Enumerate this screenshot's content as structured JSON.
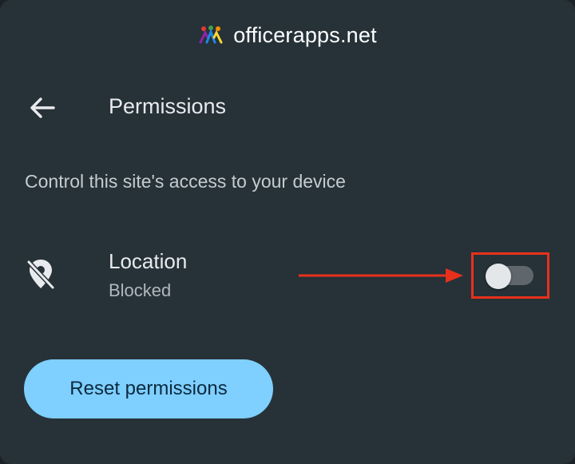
{
  "header": {
    "domain": "officerapps.net",
    "logo_icon": "officerapps-logo-icon"
  },
  "nav": {
    "back_icon": "arrow-left-icon",
    "title": "Permissions"
  },
  "description": "Control this site's access to your device",
  "permissions": [
    {
      "name": "Location",
      "status": "Blocked",
      "icon": "location-off-icon",
      "enabled": false
    }
  ],
  "annotation": {
    "color": "#e8301c",
    "type": "arrow-and-highlight-box"
  },
  "reset_button": {
    "label": "Reset permissions"
  },
  "colors": {
    "background": "#263238",
    "primary_text": "#e8eaed",
    "secondary_text": "#b0b8be",
    "accent_button": "#7fcfff",
    "toggle_track_off": "#5f676d",
    "toggle_thumb": "#e4e7e9"
  }
}
